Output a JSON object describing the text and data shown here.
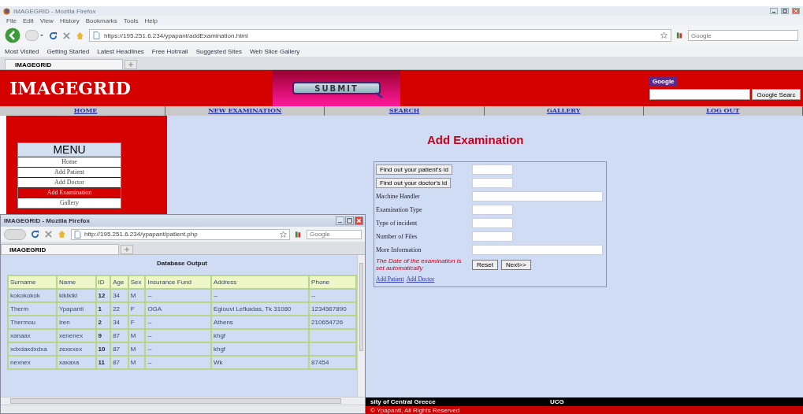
{
  "browser": {
    "title": "IMAGEGRID - Mozilla Firefox",
    "menu": [
      "File",
      "Edit",
      "View",
      "History",
      "Bookmarks",
      "Tools",
      "Help"
    ],
    "url": "https://195.251.6.234/ypapant/addExamination.html",
    "bookmarks": [
      "Most Visited",
      "Getting Started",
      "Latest Headlines",
      "Free Hotmail",
      "Suggested Sites",
      "Web Slice Gallery"
    ],
    "tab": "IMAGEGRID",
    "search_placeholder": "Google"
  },
  "header": {
    "logo": "IMAGEGRID",
    "banner_button": "SUBMIT",
    "google_logo": "Google",
    "google_button": "Google Searc"
  },
  "nav": [
    {
      "label": "HOME"
    },
    {
      "label": "NEW EXAMINATION"
    },
    {
      "label": "SEARCH"
    },
    {
      "label": "GALLERY"
    },
    {
      "label": "LOG OUT"
    }
  ],
  "sidebar": {
    "title": "MENU",
    "items": [
      {
        "label": "Home",
        "selected": false
      },
      {
        "label": "Add Patient",
        "selected": false
      },
      {
        "label": "Add Doctor",
        "selected": false
      },
      {
        "label": "Add Examination",
        "selected": true
      },
      {
        "label": "Gallery",
        "selected": false
      }
    ]
  },
  "form": {
    "title": "Add Examination",
    "rows": [
      {
        "kind": "lookup",
        "label": "Find out your patient's id"
      },
      {
        "kind": "lookup",
        "label": "Find out your doctor's id"
      },
      {
        "kind": "long",
        "label": "Machine Handler"
      },
      {
        "kind": "short",
        "label": "Examination Type"
      },
      {
        "kind": "short",
        "label": "Type of incident"
      },
      {
        "kind": "short",
        "label": "Number of Files"
      },
      {
        "kind": "long",
        "label": "More Information"
      }
    ],
    "note": "The Date of the examination is set automatically",
    "buttons": [
      "Reset",
      "Next>>"
    ],
    "links": [
      "Add Patient",
      "Add Doctor"
    ]
  },
  "footer": {
    "left": "sity of Central Greece",
    "middle": "UCG",
    "copyright": "© Ypapanti, All Rights Reserved"
  },
  "popup": {
    "title": "IMAGEGRID - Mozilla Firefox",
    "url": "http://195.251.6.234/ypapant/patient.php",
    "tab": "IMAGEGRID",
    "search_placeholder": "Google",
    "heading": "Database Output",
    "table": {
      "columns": [
        "Surname",
        "Name",
        "ID",
        "Age",
        "Sex",
        "Insurance Fund",
        "Address",
        "Phone"
      ],
      "rows": [
        {
          "cells": [
            "kokokokok",
            "kikikiki",
            "12",
            "34",
            "M",
            "--",
            "--",
            "--"
          ]
        },
        {
          "cells": [
            "Therm",
            "Ypapanti",
            "1",
            "22",
            "F",
            "OGA",
            "Eglouvi Lefkadas, Tk 31080",
            "1234567890"
          ]
        },
        {
          "cells": [
            "Thermou",
            "Iren",
            "2",
            "34",
            "F",
            "--",
            "Athens",
            "210654726"
          ]
        },
        {
          "cells": [
            "xanaax",
            "xenenex",
            "9",
            "87",
            "M",
            "--",
            "khgf"
          ]
        },
        {
          "cells": [
            "xdxdaxdxdxa",
            "zexexex",
            "10",
            "87",
            "M",
            "--",
            "khgf"
          ]
        },
        {
          "cells": [
            "nexnex",
            "xaxaxa",
            "11",
            "87",
            "M",
            "--",
            "Wk",
            "87454"
          ]
        }
      ]
    }
  }
}
